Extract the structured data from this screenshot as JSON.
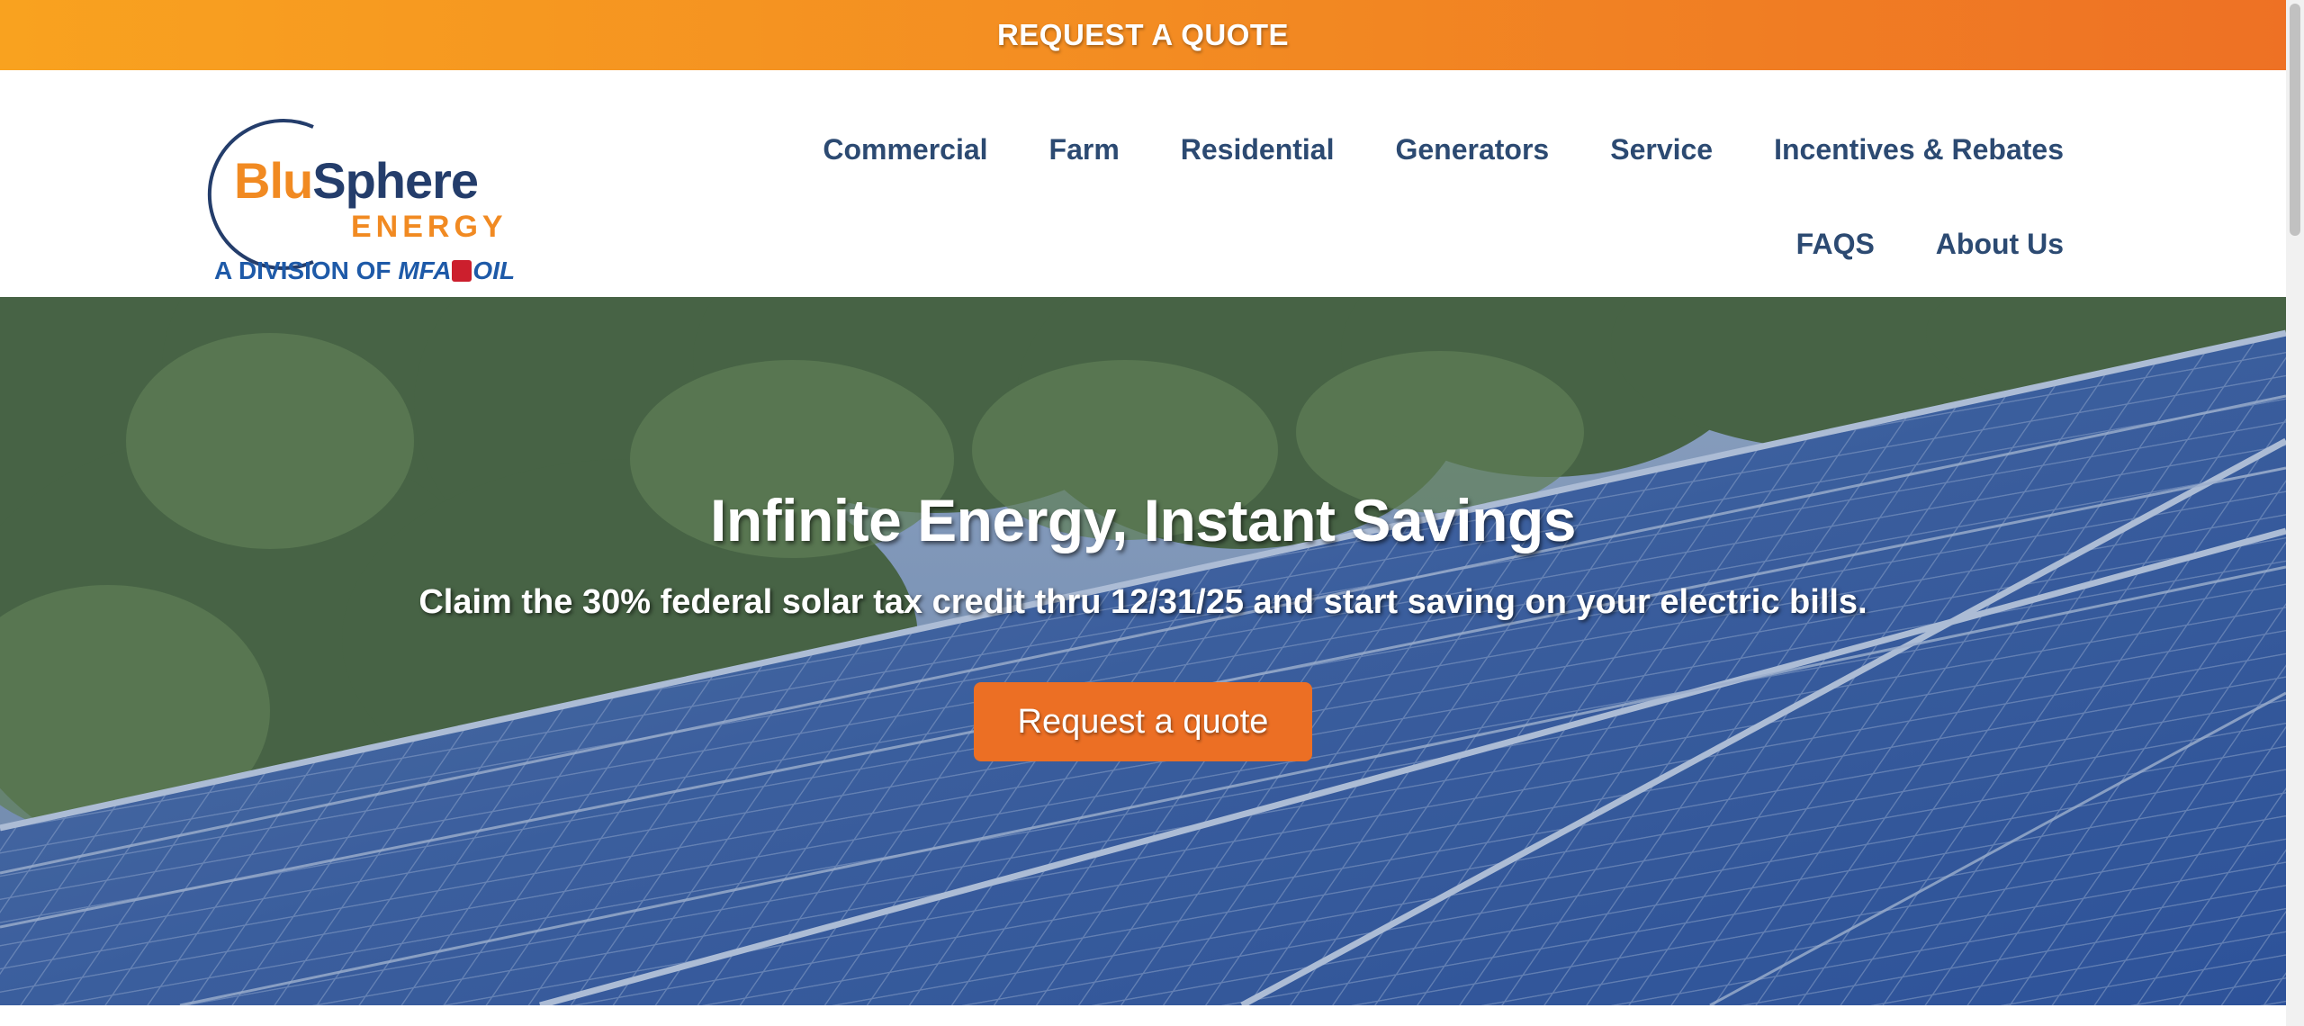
{
  "promo_bar": {
    "label": "REQUEST A QUOTE"
  },
  "logo": {
    "brand_part1": "Blu",
    "brand_part2": "Sphere",
    "tagline": "ENERGY",
    "division_prefix": "A DIVISION OF ",
    "division_mfa": "MFA",
    "division_oil": "OIL"
  },
  "nav": {
    "row1": [
      "Commercial",
      "Farm",
      "Residential",
      "Generators",
      "Service",
      "Incentives & Rebates"
    ],
    "row2": [
      "FAQS",
      "About Us"
    ]
  },
  "hero": {
    "headline": "Infinite Energy, Instant Savings",
    "subhead": "Claim the 30% federal solar tax credit thru 12/31/25 and start saving on your electric bills.",
    "cta_label": "Request a quote"
  },
  "colors": {
    "orange": "#f18a22",
    "navy": "#243d6b",
    "nav_text": "#2c4a72",
    "cta": "#ec6f24"
  }
}
